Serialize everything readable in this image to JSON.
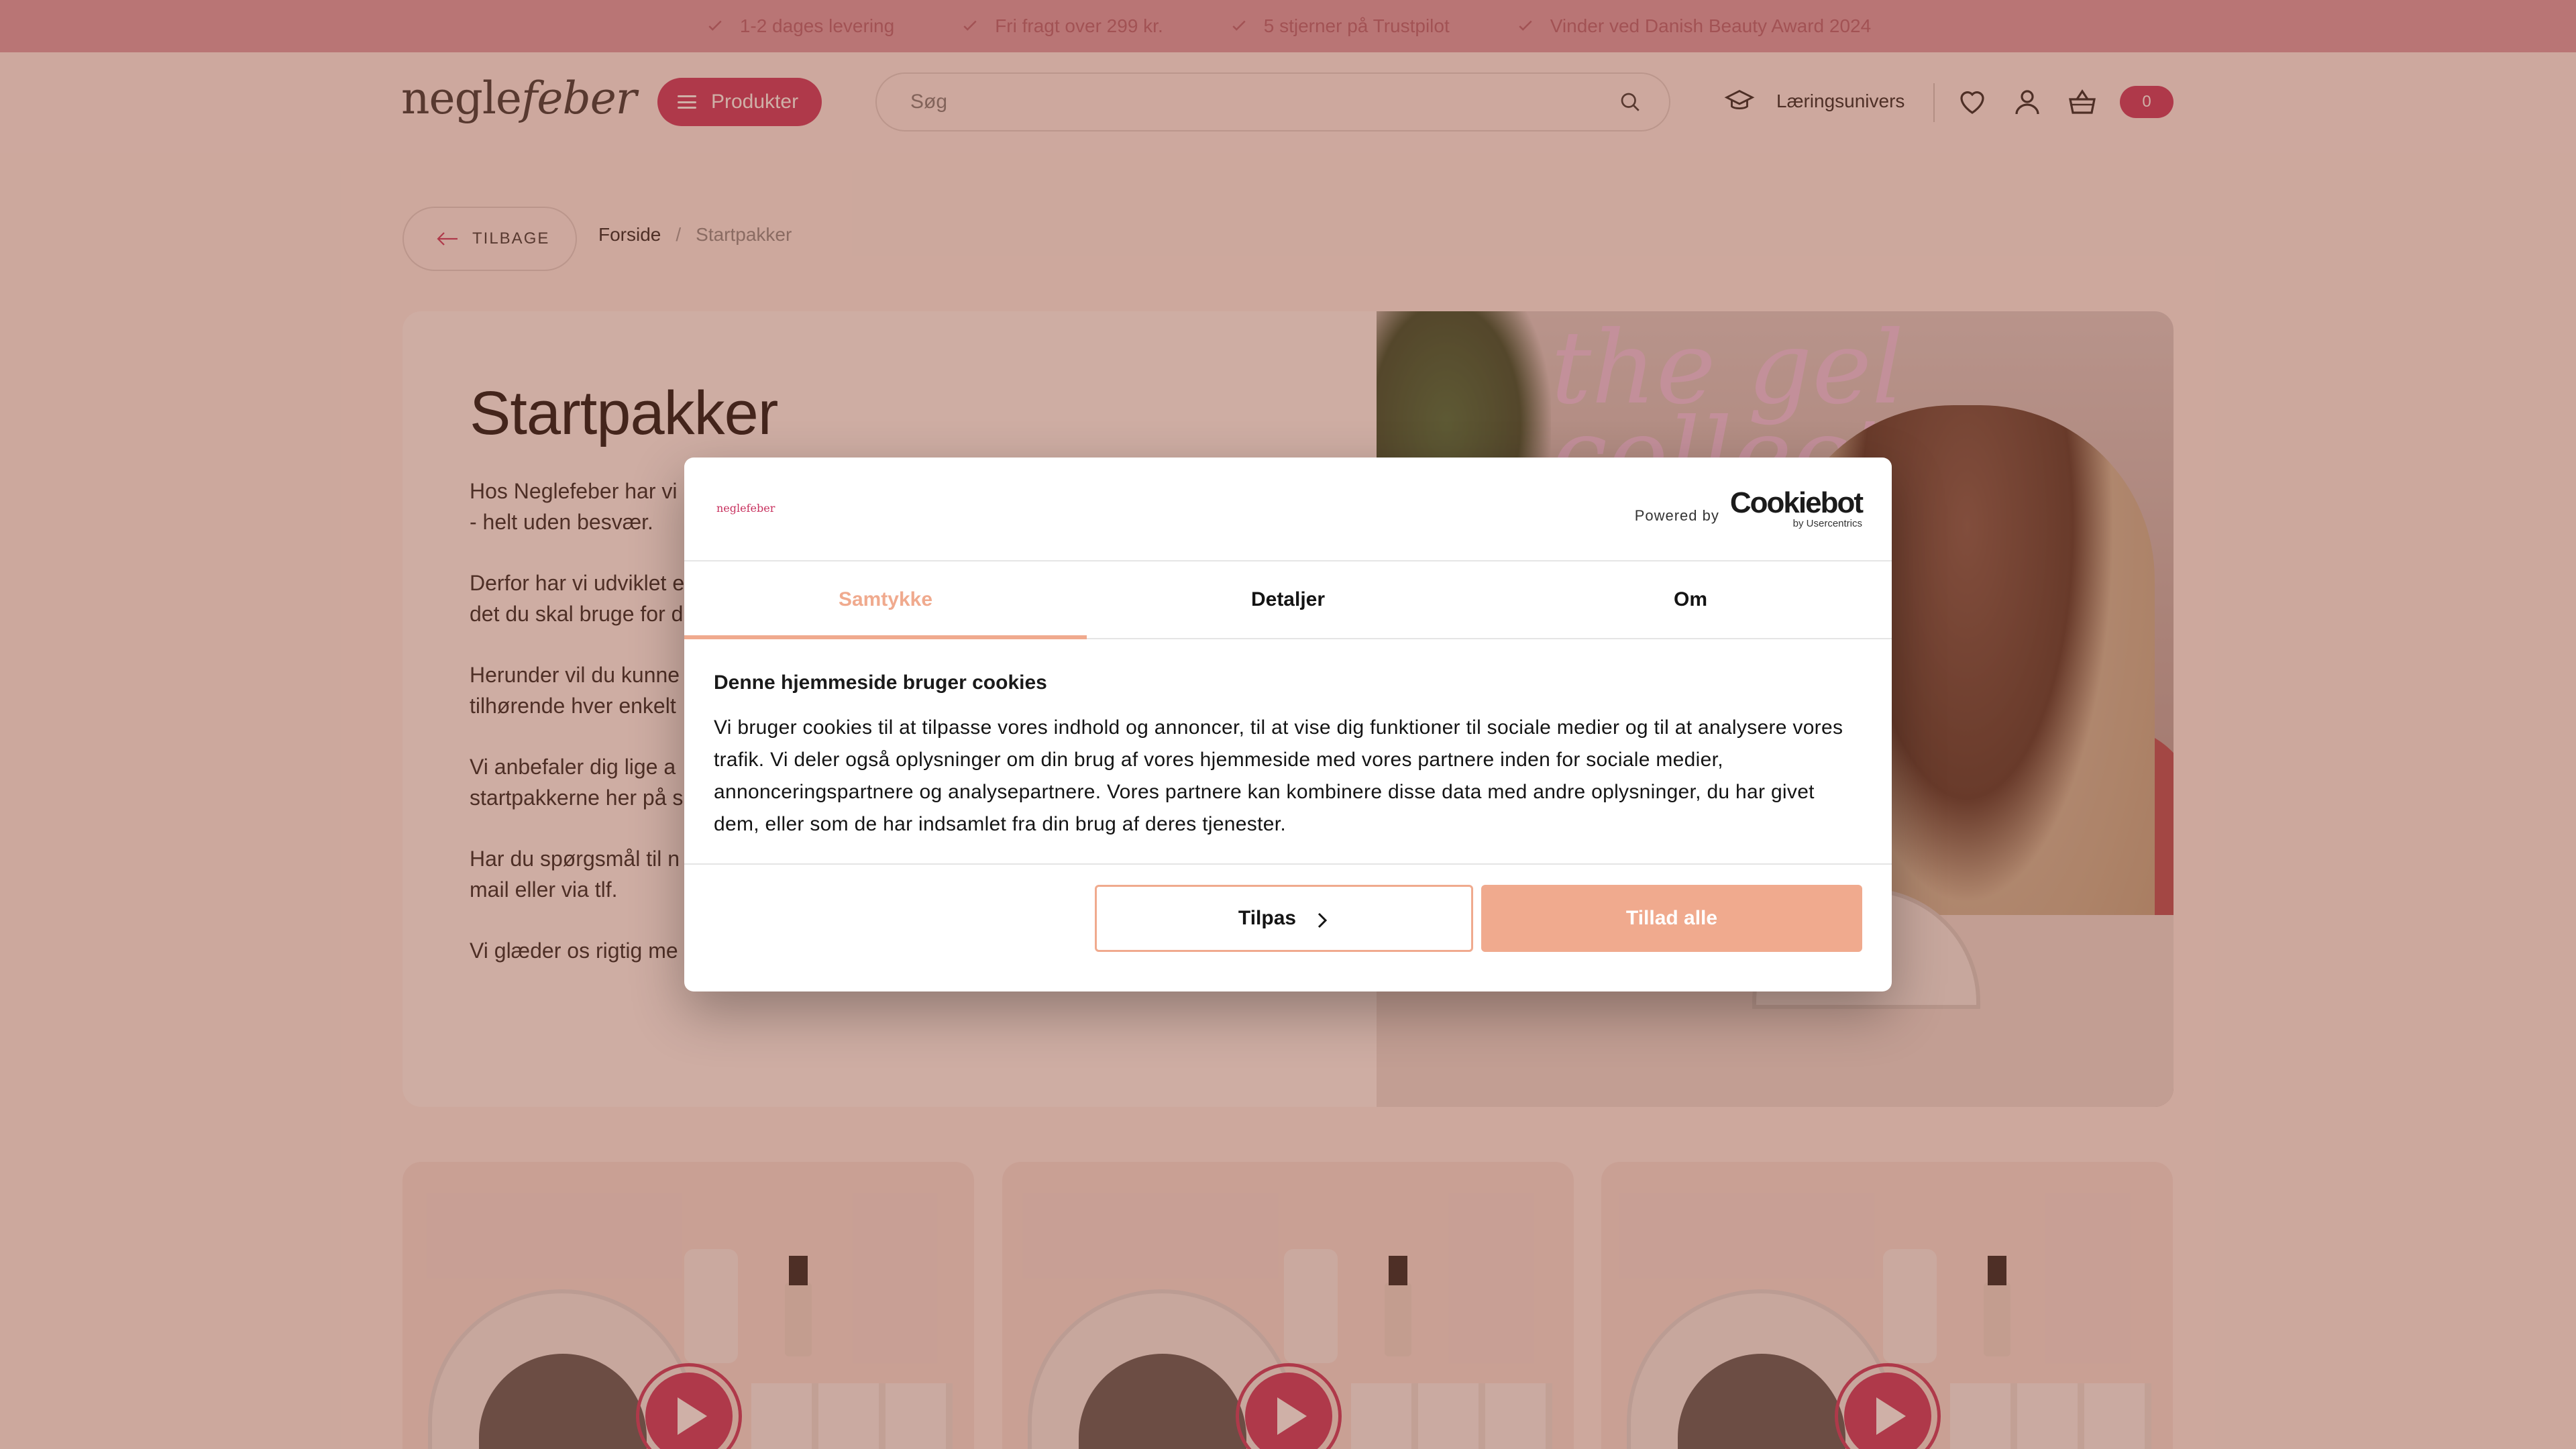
{
  "usp_bar": {
    "items": [
      "1-2 dages levering",
      "Fri fragt over 299 kr.",
      "5 stjerner på Trustpilot",
      "Vinder ved Danish Beauty Award 2024"
    ]
  },
  "header": {
    "logo_part1": "negle",
    "logo_part2": "feber",
    "products_label": "Produkter",
    "search_placeholder": "Søg",
    "learning_label": "Læringsunivers",
    "cart_count": "0"
  },
  "breadcrumb": {
    "back_label": "TILBAGE",
    "home": "Forside",
    "separator": "/",
    "current": "Startpakker"
  },
  "hero": {
    "title": "Startpakker",
    "paragraphs": [
      "Hos Neglefeber har vi\n- helt uden besvær.",
      "Derfor har vi udviklet e\ndet du skal bruge for d",
      "Herunder vil du kunne\ntilhørende hver enkelt",
      "Vi anbefaler dig lige a\nstartpakkerne her på s",
      "Har du spørgsmål til n\nmail eller via tlf.",
      "Vi glæder os rigtig me"
    ]
  },
  "cookie_dialog": {
    "logo_text": "neglefeber",
    "powered_by": "Powered by",
    "brand": "Cookiebot",
    "brand_sub": "by Usercentrics",
    "tabs": [
      "Samtykke",
      "Detaljer",
      "Om"
    ],
    "heading": "Denne hjemmeside bruger cookies",
    "body": "Vi bruger cookies til at tilpasse vores indhold og annoncer, til at vise dig funktioner til sociale medier og til at analysere vores trafik. Vi deler også oplysninger om din brug af vores hjemmeside med vores partnere inden for sociale medier, annonceringspartnere og analysepartnere. Vores partnere kan kombinere disse data med andre oplysninger, du har givet dem, eller som de har indsamlet fra din brug af deres tjenester.",
    "btn_customize": "Tilpas",
    "btn_allow_all": "Tillad alle"
  },
  "colors": {
    "brand_pink": "#c8325f",
    "cookie_accent": "#f0aa8e",
    "usp_bar": "#d99aaa"
  }
}
